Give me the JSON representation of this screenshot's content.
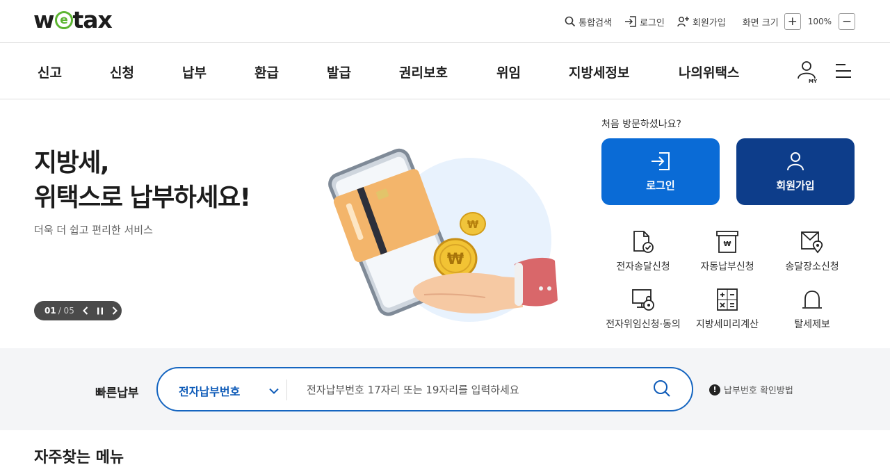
{
  "header": {
    "logo_prefix": "w",
    "logo_e": "e",
    "logo_suffix": "tax",
    "utils": {
      "search": "통합검색",
      "login": "로그인",
      "join": "회원가입",
      "zoom_label": "화면 크기",
      "zoom_plus": "+",
      "zoom_value": "100%",
      "zoom_minus": "−"
    }
  },
  "gnb": {
    "items": [
      "신고",
      "신청",
      "납부",
      "환급",
      "발급",
      "권리보호",
      "위임",
      "지방세정보",
      "나의위택스"
    ],
    "my_label": "MY"
  },
  "hero": {
    "title_line1": "지방세,",
    "title_line2": "위택스로 납부하세요!",
    "subtitle": "더욱 더 쉽고 편리한 서비스",
    "pager_current": "01",
    "pager_total": "/ 05",
    "coin_symbol": "₩"
  },
  "side": {
    "first_visit": "처음 방문하셨나요?",
    "login_label": "로그인",
    "join_label": "회원가입",
    "quick": [
      {
        "label": "전자송달신청",
        "icon": "document-check-icon"
      },
      {
        "label": "자동납부신청",
        "icon": "receipt-icon"
      },
      {
        "label": "송달장소신청",
        "icon": "mail-location-icon"
      },
      {
        "label": "전자위임신청·동의",
        "icon": "monitor-lock-icon"
      },
      {
        "label": "지방세미리계산",
        "icon": "calculator-icon"
      },
      {
        "label": "탈세제보",
        "icon": "alarm-bell-icon"
      }
    ]
  },
  "fast_pay": {
    "label": "빠른납부",
    "select_value": "전자납부번호",
    "placeholder": "전자납부번호 17자리 또는 19자리를 입력하세요",
    "help_text": "납부번호 확인방법",
    "help_mark": "!"
  },
  "section": {
    "frequent_title": "자주찾는 메뉴"
  },
  "colors": {
    "primary": "#0a6bd6",
    "navy": "#0d3d8a",
    "logo_green": "#5cb531"
  }
}
